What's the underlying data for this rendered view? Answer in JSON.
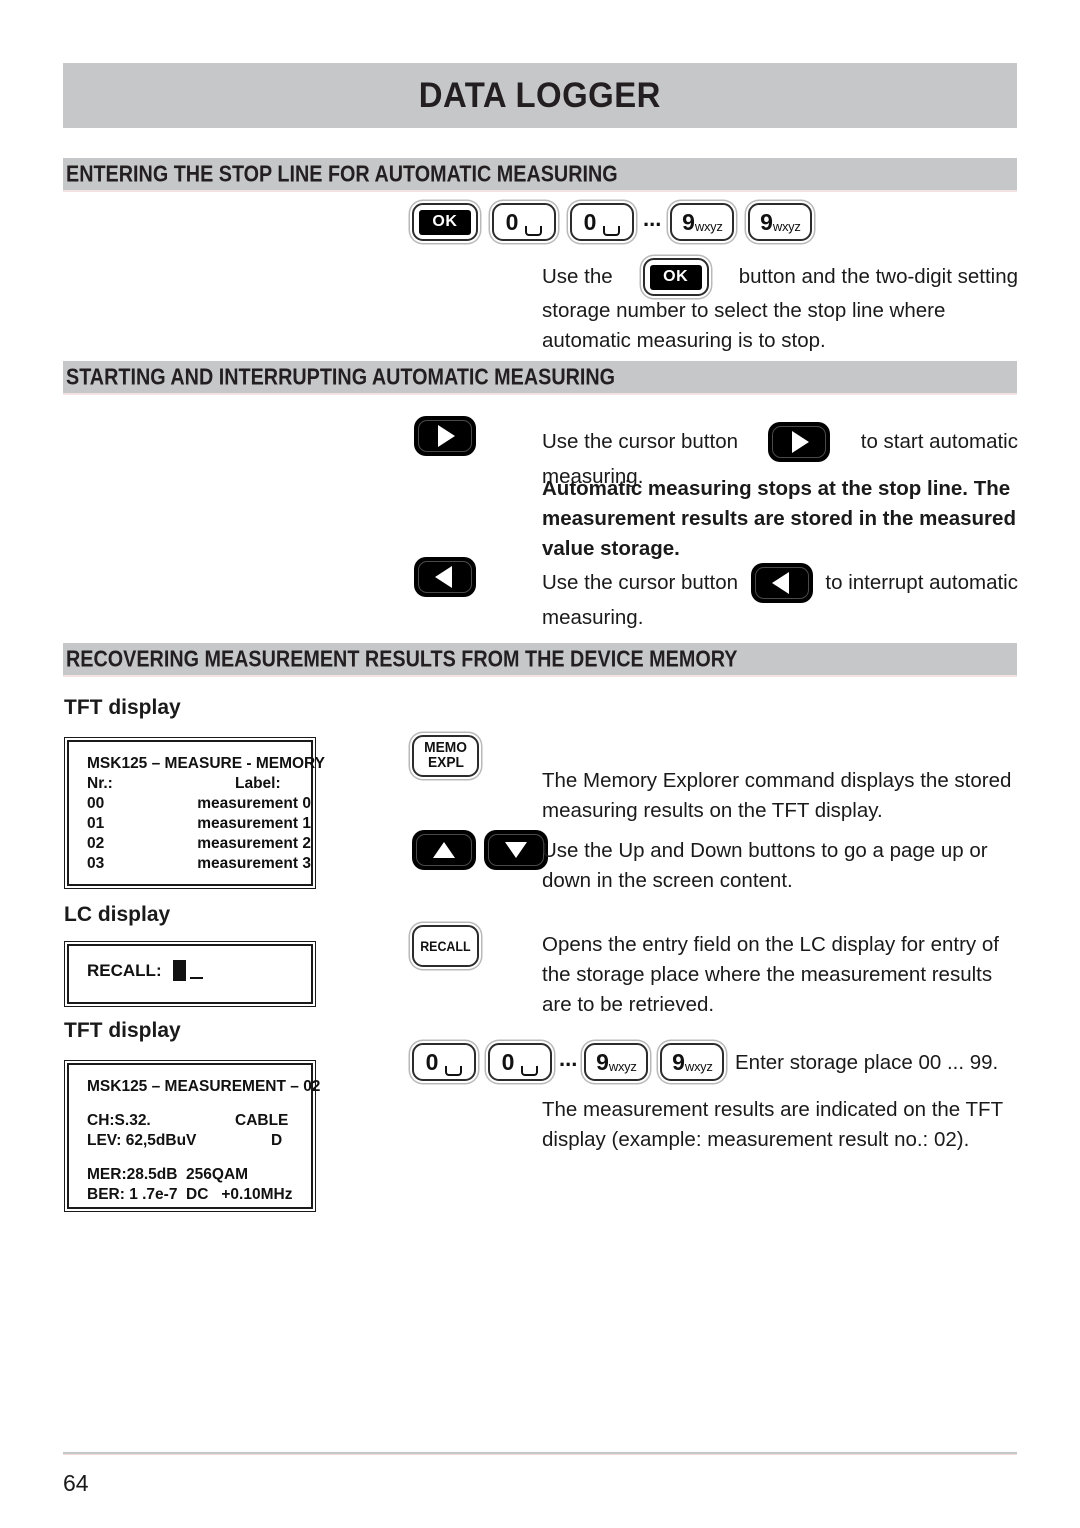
{
  "document": {
    "title": "DATA LOGGER",
    "page_number": "64"
  },
  "sections": [
    {
      "heading": "ENTERING THE STOP LINE FOR AUTOMATIC MEASURING",
      "keys": [
        "OK",
        "0",
        "0",
        "...",
        "9wxyz",
        "9wxyz"
      ],
      "paragraph_lines": [
        "Use the",
        "button and the two-digit setting",
        "storage number to select the stop line where",
        "automatic measuring is to stop."
      ]
    },
    {
      "heading": "STARTING AND INTERRUPTING AUTOMATIC MEASURING",
      "start": {
        "text_before": "Use the cursor button",
        "text_after": "to start automatic",
        "text_line2": "measuring.",
        "bold_lines": [
          "Automatic measuring stops at the stop line. The",
          "measurement results are stored in the measured",
          "value storage."
        ]
      },
      "interrupt": {
        "text_before": "Use the cursor button",
        "text_after": "to interrupt automatic",
        "text_line2": "measuring."
      }
    },
    {
      "heading": "RECOVERING MEASUREMENT RESULTS FROM THE DEVICE MEMORY",
      "labels": {
        "tft_display_1": "TFT display",
        "lc_display": "LC display",
        "tft_display_2": "TFT display"
      },
      "tft_memory": {
        "title": "MSK125 – MEASURE - MEMORY",
        "col_headers": [
          "Nr.:",
          "Label:"
        ],
        "rows": [
          {
            "nr": "00",
            "label": "measurement 0"
          },
          {
            "nr": "01",
            "label": "measurement 1"
          },
          {
            "nr": "02",
            "label": "measurement 2"
          },
          {
            "nr": "03",
            "label": "measurement 3"
          }
        ]
      },
      "lc_display": {
        "prompt": "RECALL:"
      },
      "tft_measurement": {
        "title": "MSK125 – MEASUREMENT – 02",
        "channel": "CH:S.32.",
        "network": "CABLE",
        "level": "LEV: 62,5dBuV",
        "standard": "D",
        "mer": "MER:28.5dB  256QAM",
        "ber": "BER: 1 .7e-7  DC   +0.10MHz"
      },
      "memo_expl": {
        "key_line1": "MEMO",
        "key_line2": "EXPL",
        "paragraph_lines": [
          "The Memory Explorer command displays the stored",
          "measuring results on the TFT display."
        ]
      },
      "updown": {
        "paragraph_lines": [
          "Use the Up and Down buttons to go a page up or",
          "down in the screen content."
        ]
      },
      "recall": {
        "key_label": "RECALL",
        "paragraph_lines": [
          "Opens the entry field on the LC display for entry of",
          "the storage place where the measurement results",
          "are to be retrieved."
        ]
      },
      "digits_entry": {
        "keys": [
          "0",
          "0",
          "...",
          "9wxyz",
          "9wxyz"
        ],
        "text": "Enter storage place 00 ... 99.",
        "result_lines": [
          "The measurement results are indicated on the TFT",
          "display (example: measurement result no.: 02)."
        ]
      }
    }
  ],
  "icons": {
    "ok": "ok-key-icon",
    "digit_zero": "digit-zero-key-icon",
    "digit_nine": "digit-nine-key-icon",
    "cursor_right": "cursor-right-icon",
    "cursor_left": "cursor-left-icon",
    "cursor_up": "cursor-up-icon",
    "cursor_down": "cursor-down-icon",
    "memo_expl": "memo-expl-key-icon",
    "recall": "recall-key-icon"
  },
  "colors": {
    "band_gray": "#c6c7c9",
    "text": "#1a1a1a",
    "key_black": "#000000"
  }
}
